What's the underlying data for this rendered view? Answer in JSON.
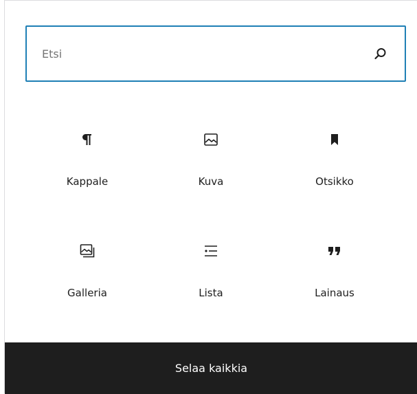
{
  "search": {
    "placeholder": "Etsi",
    "value": ""
  },
  "blocks": [
    {
      "label": "Kappale",
      "icon": "paragraph-icon"
    },
    {
      "label": "Kuva",
      "icon": "image-icon"
    },
    {
      "label": "Otsikko",
      "icon": "bookmark-icon"
    },
    {
      "label": "Galleria",
      "icon": "gallery-icon"
    },
    {
      "label": "Lista",
      "icon": "list-icon"
    },
    {
      "label": "Lainaus",
      "icon": "quote-icon"
    }
  ],
  "footer": {
    "browse_all_label": "Selaa kaikkia"
  },
  "colors": {
    "accent": "#1e7fb5",
    "footer_bg": "#1e1e1e",
    "text": "#1e1e1e"
  }
}
